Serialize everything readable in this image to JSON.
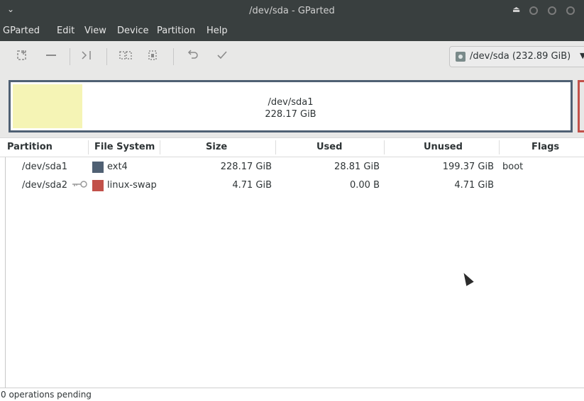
{
  "window": {
    "title": "/dev/sda - GParted",
    "menu_arrow": "⌄",
    "eject_symbol": "⏏"
  },
  "menubar": {
    "items": [
      "GParted",
      "Edit",
      "View",
      "Device",
      "Partition",
      "Help"
    ]
  },
  "toolbar": {
    "icons": [
      "new-partition-icon",
      "delete-partition-icon",
      "resize-move-icon",
      "copy-icon",
      "paste-icon",
      "undo-icon",
      "apply-icon"
    ],
    "device_selector": "/dev/sda  (232.89 GiB)"
  },
  "disk_map": {
    "partition_name": "/dev/sda1",
    "partition_size": "228.17 GiB",
    "colors": {
      "ext4_border": "#4f6073",
      "used_fill": "#f5f4b5",
      "swap_border": "#c2514a"
    }
  },
  "table": {
    "headers": [
      "Partition",
      "File System",
      "Size",
      "Used",
      "Unused",
      "Flags"
    ],
    "rows": [
      {
        "partition": "/dev/sda1",
        "filesystem": "ext4",
        "fs_color": "#4f6073",
        "size": "228.17 GiB",
        "used": "28.81 GiB",
        "unused": "199.37 GiB",
        "flags": "boot",
        "mounted_icon": false
      },
      {
        "partition": "/dev/sda2",
        "filesystem": "linux-swap",
        "fs_color": "#c2514a",
        "size": "4.71 GiB",
        "used": "0.00 B",
        "unused": "4.71 GiB",
        "flags": "",
        "mounted_icon": true
      }
    ]
  },
  "status": {
    "text": "0 operations pending"
  }
}
